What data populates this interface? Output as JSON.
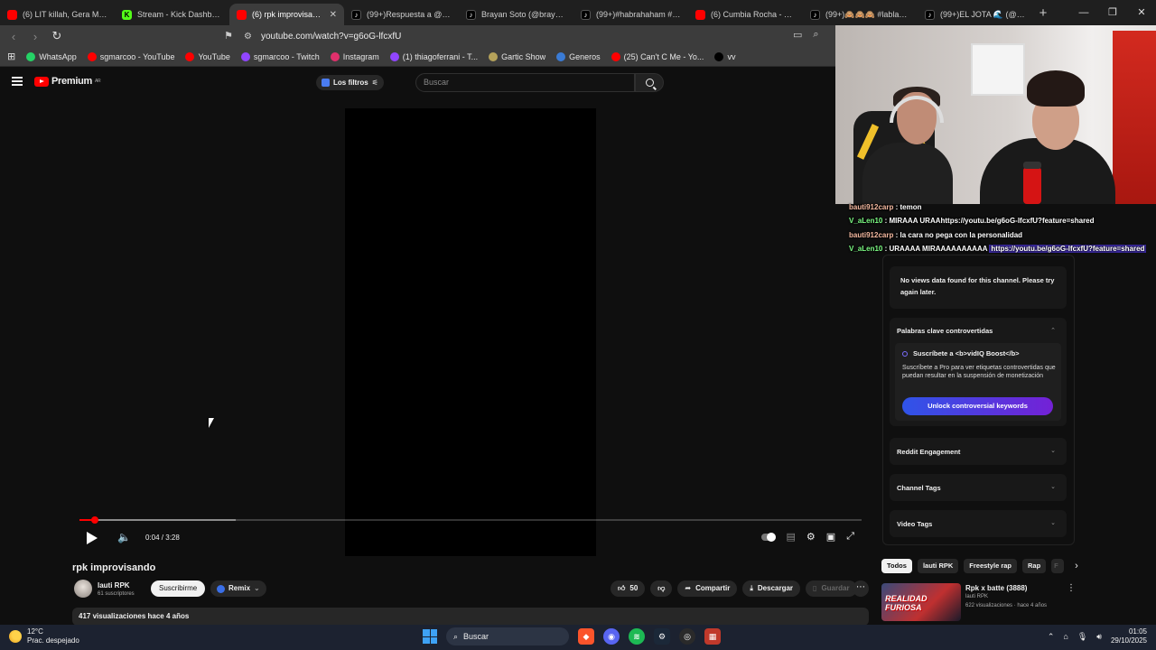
{
  "browser": {
    "tabs": [
      {
        "label": "(6) LIT killah, Gera MX - La",
        "icon": "yt",
        "active": false
      },
      {
        "label": "Stream - Kick Dashboard",
        "icon": "kick",
        "active": false
      },
      {
        "label": "(6) rpk improvisando",
        "icon": "yt",
        "active": true
      },
      {
        "label": "(99+)Respuesta a @guille",
        "icon": "tt",
        "active": false
      },
      {
        "label": "Brayan Soto (@brayan.sot",
        "icon": "tt",
        "active": false
      },
      {
        "label": "(99+)#habrahaham #core",
        "icon": "tt",
        "active": false
      },
      {
        "label": "(6) Cumbia Rocha - Tu sil",
        "icon": "yt",
        "active": false
      },
      {
        "label": "(99+)🙈🙈🙈 #lablancat",
        "icon": "tt",
        "active": false
      },
      {
        "label": "(99+)EL JOTA 🌊 (@jotaf",
        "icon": "tt",
        "active": false
      }
    ],
    "url": "youtube.com/watch?v=g6oG-lfcxfU",
    "bookmarks": [
      {
        "label": "WhatsApp",
        "color": "#25d366"
      },
      {
        "label": "sgmarcoo - YouTube",
        "color": "#ff0000"
      },
      {
        "label": "YouTube",
        "color": "#ff0000"
      },
      {
        "label": "sgmarcoo - Twitch",
        "color": "#9146ff"
      },
      {
        "label": "Instagram",
        "color": "#e1306c"
      },
      {
        "label": "(1) thiagoferrani - T...",
        "color": "#9146ff"
      },
      {
        "label": "Gartic Show",
        "color": "#b5a25a"
      },
      {
        "label": "Generos",
        "color": "#3a7bd5"
      },
      {
        "label": "(25) Can't C Me - Yo...",
        "color": "#ff0000"
      },
      {
        "label": "vv",
        "color": "#000000"
      }
    ]
  },
  "youtube": {
    "logo_text": "Premium",
    "logo_sup": "AR",
    "filter_label": "Los filtros",
    "search_placeholder": "Buscar",
    "video": {
      "title": "rpk improvisando",
      "time_current": "0:04",
      "time_total": "3:28",
      "timecode": "0:04 / 3:28",
      "progress_fraction": 0.02,
      "buffered_fraction": 0.2
    },
    "channel": {
      "name": "lauti RPK",
      "subscribers": "61 suscriptores",
      "subscribe_label": "Suscribirme",
      "remix_label": "Remix"
    },
    "actions": {
      "likes": "50",
      "share": "Compartir",
      "download": "Descargar",
      "save": "Guardar"
    },
    "description_meta": "417 visualizaciones  hace 4 años"
  },
  "chat": [
    {
      "user": "bauti912carp",
      "sep": " : ",
      "message": "temon",
      "link": "",
      "user_color": "orange"
    },
    {
      "user": "V_aLen10",
      "sep": " : ",
      "message": "MIRAAA URAA",
      "link": "https://youtu.be/g6oG-lfcxfU?feature=shared",
      "user_color": "green"
    },
    {
      "user": "bauti912carp",
      "sep": " : ",
      "message": "la cara no pega con la personalidad",
      "link": "",
      "user_color": "orange"
    },
    {
      "user": "V_aLen10",
      "sep": " : ",
      "message": "URAAAA MIRAAAAAAAAAA ",
      "link": "https://youtu.be/g6oG-lfcxfU?feature=shared",
      "user_color": "green"
    }
  ],
  "vidiq": {
    "no_data": "No views data found for this channel. Please try again later.",
    "keywords_title": "Palabras clave controvertidas",
    "card_title": "Suscríbete a <b>vidIQ Boost</b>",
    "card_desc": "Suscríbete a Pro para ver etiquetas controvertidas que puedan resultar en la suspensión de monetización",
    "unlock_label": "Unlock controversial keywords",
    "sections": [
      "Reddit Engagement",
      "Channel Tags",
      "Video Tags"
    ]
  },
  "related": {
    "chips": [
      "Todos",
      "lauti RPK",
      "Freestyle rap",
      "Rap",
      "F"
    ],
    "video": {
      "thumb_text": "REALIDAD FURIOSA",
      "title": "Rpk x  batte  (3888)",
      "channel": "lauti RPK",
      "meta": "622 visualizaciones · hace 4 años"
    }
  },
  "taskbar": {
    "temp": "12°C",
    "weather": "Prac. despejado",
    "search_label": "Buscar",
    "time": "01:05",
    "date": "29/10/2025"
  }
}
